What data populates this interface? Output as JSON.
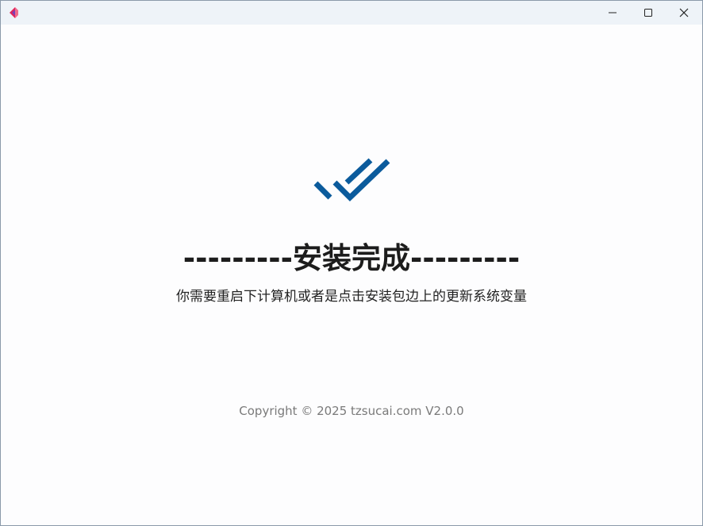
{
  "titlebar": {
    "app_icon": "app-logo-icon",
    "minimize_icon": "minimize-icon",
    "maximize_icon": "maximize-icon",
    "close_icon": "close-icon"
  },
  "main": {
    "status_icon": "double-check-icon",
    "headline": "---------安装完成---------",
    "message": "你需要重启下计算机或者是点击安装包边上的更新系统变量",
    "copyright": "Copyright © 2025 tzsucai.com V2.0.0"
  },
  "colors": {
    "accent": "#0b5b9c",
    "logo_primary": "#e2245a",
    "logo_secondary": "#7b3fb8",
    "titlebar_bg": "#eef3f8"
  }
}
